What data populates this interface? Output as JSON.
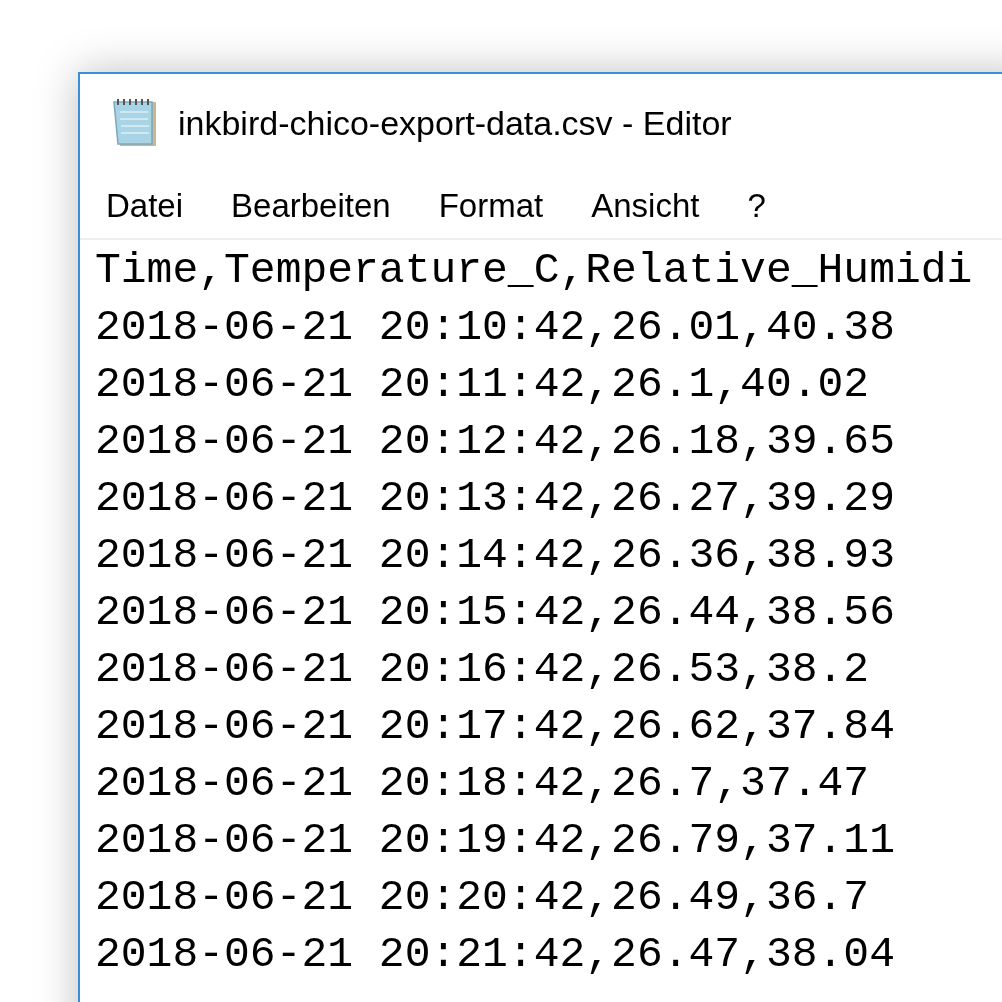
{
  "window": {
    "title": "inkbird-chico-export-data.csv - Editor"
  },
  "menu": [
    "Datei",
    "Bearbeiten",
    "Format",
    "Ansicht",
    "?"
  ],
  "editor": {
    "lines": [
      "Time,Temperature_C,Relative_Humidi",
      "2018-06-21 20:10:42,26.01,40.38",
      "2018-06-21 20:11:42,26.1,40.02",
      "2018-06-21 20:12:42,26.18,39.65",
      "2018-06-21 20:13:42,26.27,39.29",
      "2018-06-21 20:14:42,26.36,38.93",
      "2018-06-21 20:15:42,26.44,38.56",
      "2018-06-21 20:16:42,26.53,38.2",
      "2018-06-21 20:17:42,26.62,37.84",
      "2018-06-21 20:18:42,26.7,37.47",
      "2018-06-21 20:19:42,26.79,37.11",
      "2018-06-21 20:20:42,26.49,36.7",
      "2018-06-21 20:21:42,26.47,38.04"
    ]
  }
}
